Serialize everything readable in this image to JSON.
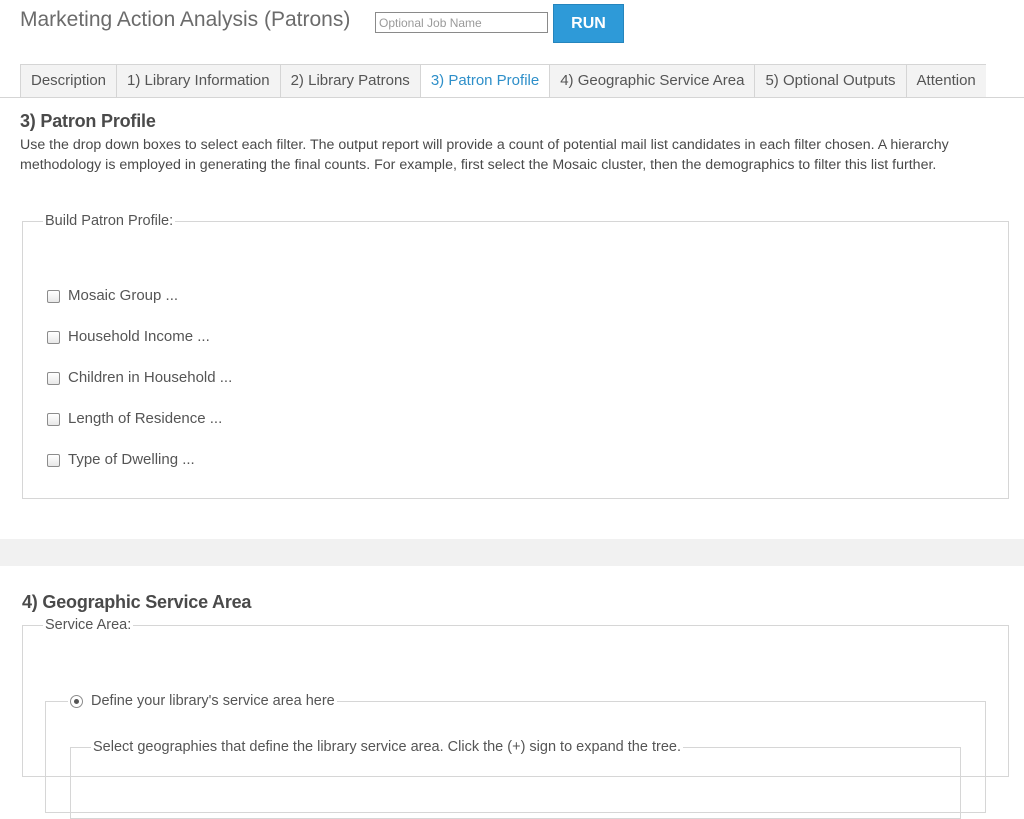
{
  "header": {
    "title": "Marketing Action Analysis (Patrons)",
    "job_name_placeholder": "Optional Job Name",
    "run_label": "RUN"
  },
  "tabs": [
    {
      "label": "Description"
    },
    {
      "label": "1) Library Information"
    },
    {
      "label": "2) Library Patrons"
    },
    {
      "label": "3) Patron Profile",
      "active": true
    },
    {
      "label": "4) Geographic Service Area"
    },
    {
      "label": "5) Optional Outputs"
    },
    {
      "label": "Attention"
    }
  ],
  "patron_profile": {
    "title": "3) Patron Profile",
    "description": "Use the drop down boxes to select each filter. The output report will provide a count of potential mail list candidates in each filter chosen. A hierarchy methodology is employed in generating the final counts. For example, first select the Mosaic cluster, then the demographics to filter this list further.",
    "fieldset_legend": "Build Patron Profile:",
    "filters": [
      {
        "label": "Mosaic Group ...",
        "checked": false
      },
      {
        "label": "Household Income ...",
        "checked": false
      },
      {
        "label": "Children in Household ...",
        "checked": false
      },
      {
        "label": "Length of Residence ...",
        "checked": false
      },
      {
        "label": "Type of Dwelling ...",
        "checked": false
      }
    ]
  },
  "geographic_service_area": {
    "title": "4) Geographic Service Area",
    "fieldset_legend": "Service Area:",
    "radio_define_label": "Define your library's service area here",
    "radio_define_selected": true,
    "geographies_legend": "Select geographies that define the library service area. Click the (+) sign to expand the tree."
  },
  "colors": {
    "accent": "#2e9ad8",
    "active_tab_text": "#2e8fc9",
    "tab_bg": "#f3f3f3",
    "band_bg": "#f1f1f1"
  }
}
